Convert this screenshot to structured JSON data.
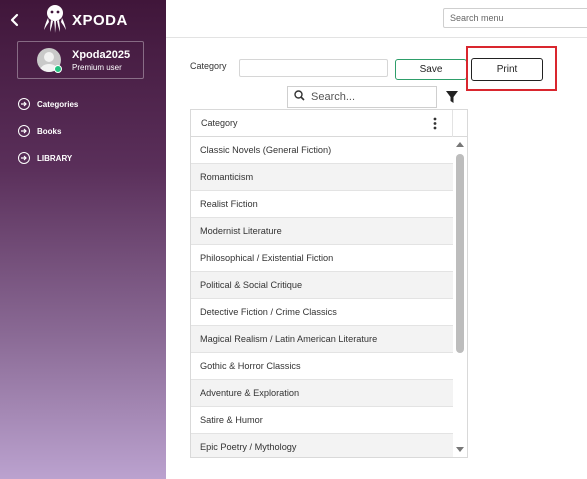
{
  "app": {
    "brand": "XPODA"
  },
  "user": {
    "name": "Xpoda2025",
    "role": "Premium user"
  },
  "sidebar": {
    "items": [
      {
        "label": "Categories",
        "icon": "arrow-right-circle-icon"
      },
      {
        "label": "Books",
        "icon": "arrow-right-circle-icon"
      },
      {
        "label": "LIBRARY",
        "icon": "arrow-right-circle-icon"
      }
    ]
  },
  "topbar": {
    "search_placeholder": "Search menu"
  },
  "form": {
    "category_label": "Category",
    "category_value": "",
    "save_label": "Save",
    "print_label": "Print"
  },
  "grid": {
    "search_placeholder": "Search...",
    "column_header": "Category",
    "rows": [
      "Classic Novels (General Fiction)",
      "Romanticism",
      "Realist Fiction",
      "Modernist Literature",
      "Philosophical / Existential Fiction",
      "Political & Social Critique",
      "Detective Fiction / Crime Classics",
      "Magical Realism / Latin American Literature",
      "Gothic & Horror Classics",
      "Adventure & Exploration",
      "Satire & Humor",
      "Epic Poetry / Mythology"
    ]
  },
  "colors": {
    "sidebar_top": "#40163a",
    "sidebar_bottom": "#bba2cf",
    "save_border": "#2e9e6a",
    "highlight": "#d9262e"
  }
}
